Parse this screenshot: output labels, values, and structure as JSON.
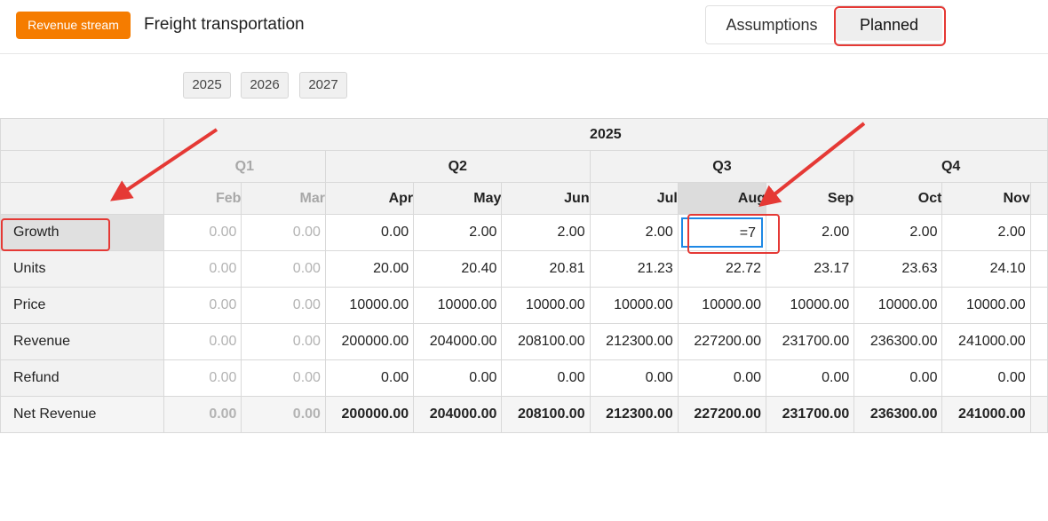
{
  "header": {
    "badge_label": "Revenue stream",
    "title": "Freight transportation",
    "view_toggle": {
      "assumptions_label": "Assumptions",
      "planned_label": "Planned",
      "selected": "Planned"
    }
  },
  "year_tabs": [
    "2025",
    "2026",
    "2027"
  ],
  "table": {
    "year": "2025",
    "quarters": [
      "Q1",
      "Q2",
      "Q3",
      "Q4"
    ],
    "months": [
      "Feb",
      "Mar",
      "Apr",
      "May",
      "Jun",
      "Jul",
      "Aug",
      "Sep",
      "Oct",
      "Nov"
    ],
    "editing_cell": {
      "row": "Growth",
      "month": "Aug",
      "input_value": "=7"
    },
    "rows": [
      {
        "label": "Growth",
        "values": [
          "0.00",
          "0.00",
          "0.00",
          "2.00",
          "2.00",
          "2.00",
          "=7",
          "2.00",
          "2.00",
          "2.00"
        ]
      },
      {
        "label": "Units",
        "values": [
          "0.00",
          "0.00",
          "20.00",
          "20.40",
          "20.81",
          "21.23",
          "22.72",
          "23.17",
          "23.63",
          "24.10"
        ]
      },
      {
        "label": "Price",
        "values": [
          "0.00",
          "0.00",
          "10000.00",
          "10000.00",
          "10000.00",
          "10000.00",
          "10000.00",
          "10000.00",
          "10000.00",
          "10000.00"
        ]
      },
      {
        "label": "Revenue",
        "values": [
          "0.00",
          "0.00",
          "200000.00",
          "204000.00",
          "208100.00",
          "212300.00",
          "227200.00",
          "231700.00",
          "236300.00",
          "241000.00"
        ]
      },
      {
        "label": "Refund",
        "values": [
          "0.00",
          "0.00",
          "0.00",
          "0.00",
          "0.00",
          "0.00",
          "0.00",
          "0.00",
          "0.00",
          "0.00"
        ]
      },
      {
        "label": "Net Revenue",
        "values": [
          "0.00",
          "0.00",
          "200000.00",
          "204000.00",
          "208100.00",
          "212300.00",
          "227200.00",
          "231700.00",
          "236300.00",
          "241000.00"
        ]
      }
    ]
  },
  "colors": {
    "badge": "#f57c00",
    "annotation_red": "#e53935",
    "edit_border": "#1e88e5"
  }
}
